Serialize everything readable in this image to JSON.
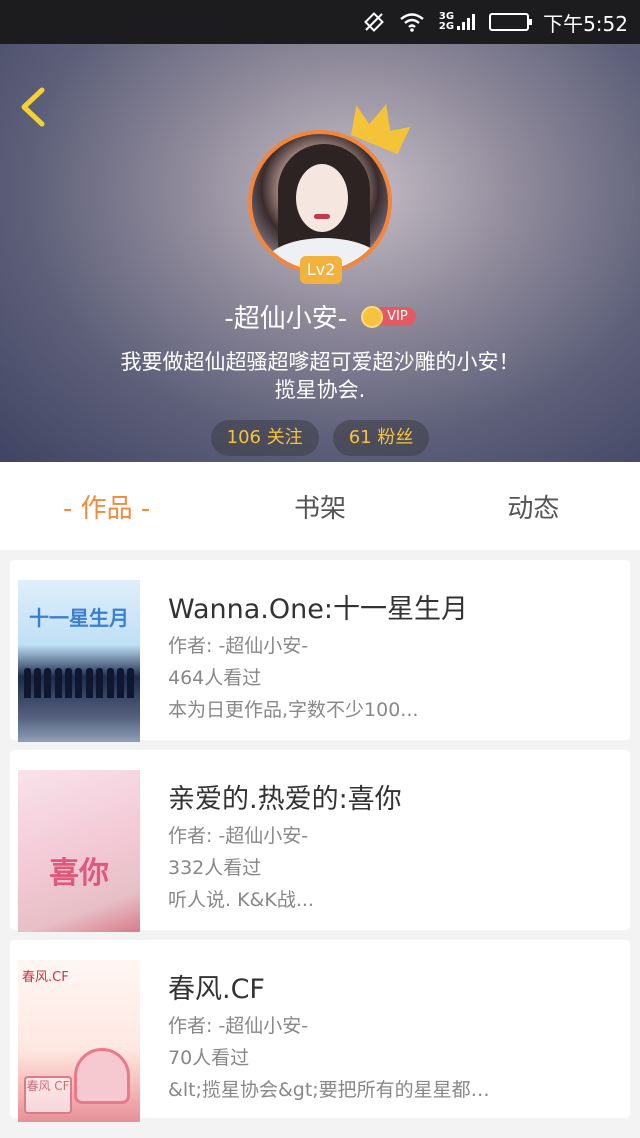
{
  "status_bar": {
    "network_3g": "3G",
    "network_2g": "2G",
    "time": "下午5:52"
  },
  "profile": {
    "level": "Lv2",
    "username": "-超仙小安-",
    "vip_label": "VIP",
    "bio_line1": "我要做超仙超骚超嗲超可爱超沙雕的小安！",
    "bio_line2": "揽星协会.",
    "following": "106 关注",
    "fans": "61 粉丝"
  },
  "tabs": [
    {
      "label": "- 作品 -",
      "active": true
    },
    {
      "label": "书架",
      "active": false
    },
    {
      "label": "动态",
      "active": false
    }
  ],
  "works": [
    {
      "title": "Wanna.One:十一星生月",
      "author": "作者: -超仙小安-",
      "views": "464人看过",
      "summary": "本为日更作品,字数不少100...",
      "cover_text": "十一星生月"
    },
    {
      "title": "亲爱的.热爱的:喜你",
      "author": "作者: -超仙小安-",
      "views": "332人看过",
      "summary": "听人说. K&K战...",
      "cover_text": "喜你"
    },
    {
      "title": "春风.CF",
      "author": "作者: -超仙小安-",
      "views": "70人看过",
      "summary": "&lt;揽星协会&gt;要把所有的星星都…",
      "cover_text": "春风.CF",
      "cover_stamp": "春风 CF"
    }
  ],
  "colors": {
    "accent": "#f08a3c",
    "gold": "#f5c338",
    "avatar_ring": "#f3863a"
  }
}
